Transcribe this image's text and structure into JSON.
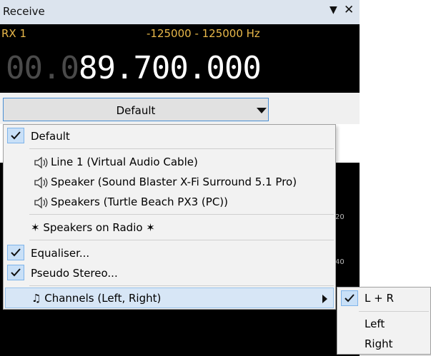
{
  "panel": {
    "title": "Receive",
    "dropdown_icon": "▼",
    "close_icon": "✕"
  },
  "receiver": {
    "label": "RX 1",
    "range": "-125000 - 125000 Hz",
    "frequency_dim": "00.0",
    "frequency_lit": "89.700.000"
  },
  "device_select": {
    "selected": "Default"
  },
  "scale_ticks": [
    "20",
    "40"
  ],
  "menu": {
    "default": "Default",
    "devices": [
      "Line 1 (Virtual Audio Cable)",
      "Speaker (Sound Blaster X-Fi Surround 5.1 Pro)",
      "Speakers (Turtle Beach PX3 (PC))"
    ],
    "speakers_on_radio": "✶ Speakers on Radio ✶",
    "equaliser": "Equaliser...",
    "pseudo_stereo": "Pseudo Stereo...",
    "channels": "♫ Channels (Left, Right)"
  },
  "submenu": {
    "both": "L + R",
    "left": "Left",
    "right": "Right"
  },
  "colors": {
    "accent_text": "#e9b84a",
    "check_bg": "#c9e0f7",
    "highlight_bg": "#d7e6f6"
  }
}
